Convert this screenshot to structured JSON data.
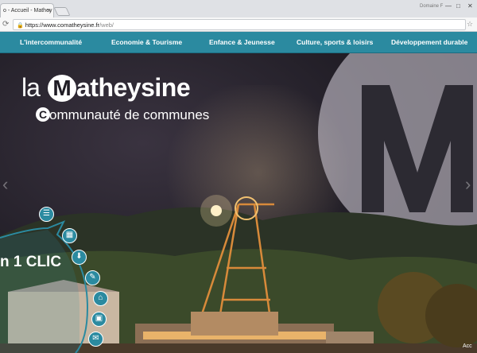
{
  "browser": {
    "tab_title": "o - Accueil - Mathey",
    "tab_close": "×",
    "profile": "Domaine F",
    "window_controls": {
      "minimize": "—",
      "maximize": "□",
      "close": "✕"
    },
    "url_host": "https://www.comatheysine.fr",
    "url_path": "/web/",
    "lock": "🔒",
    "reload": "⟳",
    "star": "☆"
  },
  "nav": {
    "items": [
      "L'intercommunalité",
      "Economie & Tourisme",
      "Enfance & Jeunesse",
      "Culture, sports & loisirs",
      "Développement durable"
    ]
  },
  "hero": {
    "logo": {
      "la": "la",
      "m": "M",
      "rest": "atheysine",
      "c": "C",
      "sub": "ommunauté de communes"
    },
    "prev": "‹",
    "next": "›",
    "quick_text": "n 1 CLIC",
    "quick_icons": [
      "list-icon",
      "map-icon",
      "download-icon",
      "book-icon",
      "building-icon",
      "calendar-icon",
      "mail-icon"
    ],
    "quick_glyphs": [
      "☰",
      "▦",
      "⬇",
      "✎",
      "⌂",
      "▣",
      "✉"
    ],
    "accessibility": "Acc"
  },
  "colors": {
    "nav": "#2b8aa0",
    "accent": "#2b8aa0"
  }
}
